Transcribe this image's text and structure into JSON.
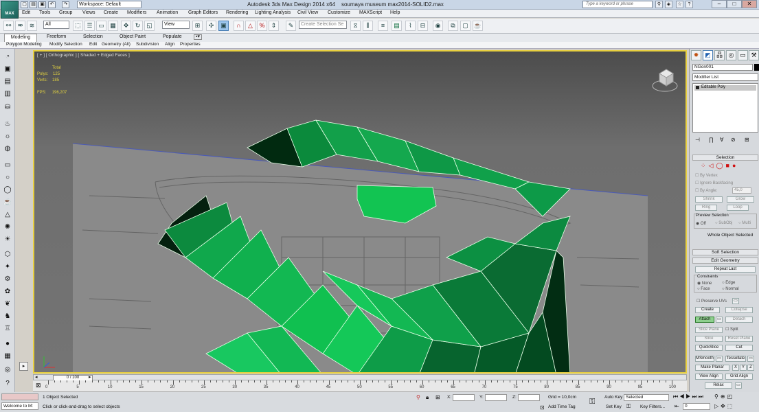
{
  "title": {
    "app_name": "Autodesk 3ds Max Design 2014 x64",
    "file": "soumaya museum max2014-SOLID2.max",
    "workspace": "Workspace: Default",
    "search_placeholder": "Type a keyword or phrase",
    "logo": "MAX"
  },
  "menu": [
    "Edit",
    "Tools",
    "Group",
    "Views",
    "Create",
    "Modifiers",
    "Animation",
    "Graph Editors",
    "Rendering",
    "Lighting Analysis",
    "Civil View",
    "Customize",
    "MAXScript",
    "Help"
  ],
  "toolbar": {
    "filter": "All",
    "ref_coord": "View",
    "selection_set_placeholder": "Create Selection Se"
  },
  "ribbon": {
    "tabs": [
      "Modeling",
      "Freeform",
      "Selection",
      "Object Paint",
      "Populate"
    ],
    "sub": [
      "Polygon Modeling",
      "Modify Selection",
      "Edit",
      "Geometry (All)",
      "Subdivision",
      "Align",
      "Properties"
    ]
  },
  "viewport": {
    "label": "[ + ] [ Orthographic ] [ Shaded + Edged Faces ]",
    "stats": {
      "total": "Total",
      "polys_label": "Polys:",
      "polys": "125",
      "verts_label": "Verts:",
      "verts": "185",
      "fps_label": "FPS:",
      "fps": "196,207"
    }
  },
  "timeline": {
    "position": "0 / 100",
    "ticks": [
      "0",
      "5",
      "10",
      "15",
      "20",
      "25",
      "30",
      "35",
      "40",
      "45",
      "50",
      "55",
      "60",
      "65",
      "70",
      "75",
      "80",
      "85",
      "90",
      "95",
      "100"
    ]
  },
  "status": {
    "maxscript": "Welcome to M:",
    "selected": "1 Object Selected",
    "prompt": "Click or click-and-drag to select objects",
    "x_label": "X:",
    "y_label": "Y:",
    "z_label": "Z:",
    "grid": "Grid = 10,0cm",
    "add_time_tag": "Add Time Tag",
    "auto_key": "Auto Key",
    "set_key": "Set Key",
    "key_mode": "Selected",
    "key_filters": "Key Filters...",
    "frame": "0"
  },
  "panel": {
    "object_name": "NGon001",
    "modifier_list": "Modifier List",
    "stack_item": "Editable Poly",
    "selection": "Selection",
    "by_vertex": "By Vertex",
    "ignore_backfacing": "Ignore Backfacing",
    "by_angle": "By Angle:",
    "angle_value": "45,0",
    "shrink": "Shrink",
    "grow": "Grow",
    "ring": "Ring",
    "loop": "Loop",
    "preview_selection": "Preview Selection",
    "off": "Off",
    "subobj": "SubObj",
    "multi": "Multi",
    "whole_object": "Whole Object Selected",
    "soft_selection": "Soft Selection",
    "edit_geometry": "Edit Geometry",
    "repeat_last": "Repeat Last",
    "constraints": "Constraints",
    "none": "None",
    "edge": "Edge",
    "face": "Face",
    "normal": "Normal",
    "preserve_uvs": "Preserve UVs",
    "create": "Create",
    "collapse": "Collapse",
    "attach": "Attach",
    "detach": "Detach",
    "slice_plane": "Slice Plane",
    "split": "Split",
    "slice": "Slice",
    "reset_plane": "Reset Plane",
    "quickslice": "QuickSlice",
    "cut": "Cut",
    "msmooth": "MSmooth",
    "tessellate": "Tessellate",
    "make_planar": "Make Planar",
    "x": "X",
    "y": "Y",
    "z": "Z",
    "view_align": "View Align",
    "grid_align": "Grid Align",
    "relax": "Relax"
  }
}
